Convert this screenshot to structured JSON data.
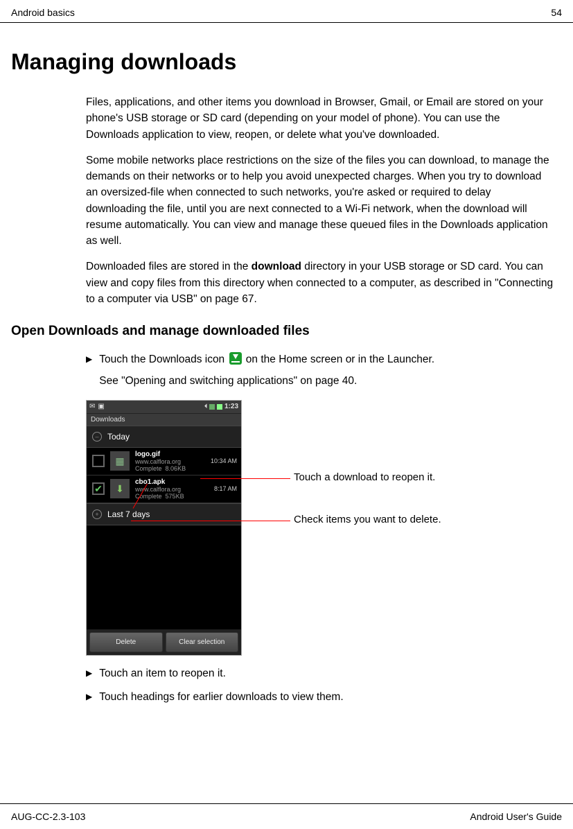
{
  "header": {
    "section": "Android basics",
    "page": "54"
  },
  "title": "Managing downloads",
  "paras": [
    "Files, applications, and other items you download in Browser, Gmail, or Email are stored on your phone's USB storage or SD card (depending on your model of phone). You can use the Downloads application to view, reopen, or delete what you've downloaded.",
    "Some mobile networks place restrictions on the size of the files you can download, to manage the demands on their networks or to help you avoid unexpected charges. When you try to download an oversized-file when connected to such networks, you're asked or required to delay downloading the file, until you are next connected to a Wi-Fi network, when the download will resume automatically. You can view and manage these queued files in the Downloads application as well."
  ],
  "para3_pre": "Downloaded files are stored in the ",
  "para3_bold": "download",
  "para3_post": " directory in your USB storage or SD card. You can view and copy files from this directory when connected to a computer, as described in \"Connecting to a computer via USB\" on page 67.",
  "subtitle": "Open Downloads and manage downloaded files",
  "step1_pre": "Touch the Downloads icon ",
  "step1_post": " on the Home screen or in the Launcher.",
  "step1_see": "See \"Opening and switching applications\" on page 40.",
  "step2": "Touch an item to reopen it.",
  "step3": "Touch headings for earlier downloads to view them.",
  "callout1": "Touch a download to reopen it.",
  "callout2": "Check items you want to delete.",
  "phone": {
    "clock": "1:23",
    "title": "Downloads",
    "groups": [
      {
        "label": "Today",
        "expanded": true,
        "items": [
          {
            "name": "logo.gif",
            "source": "www.calflora.org",
            "status": "Complete",
            "size": "8.06KB",
            "time": "10:34 AM",
            "checked": false
          },
          {
            "name": "cbo1.apk",
            "source": "www.calflora.org",
            "status": "Complete",
            "size": "575KB",
            "time": "8:17 AM",
            "checked": true
          }
        ]
      },
      {
        "label": "Last 7 days",
        "expanded": false,
        "items": []
      }
    ],
    "buttons": {
      "delete": "Delete",
      "clear": "Clear selection"
    }
  },
  "footer": {
    "left": "AUG-CC-2.3-103",
    "right": "Android User's Guide"
  }
}
